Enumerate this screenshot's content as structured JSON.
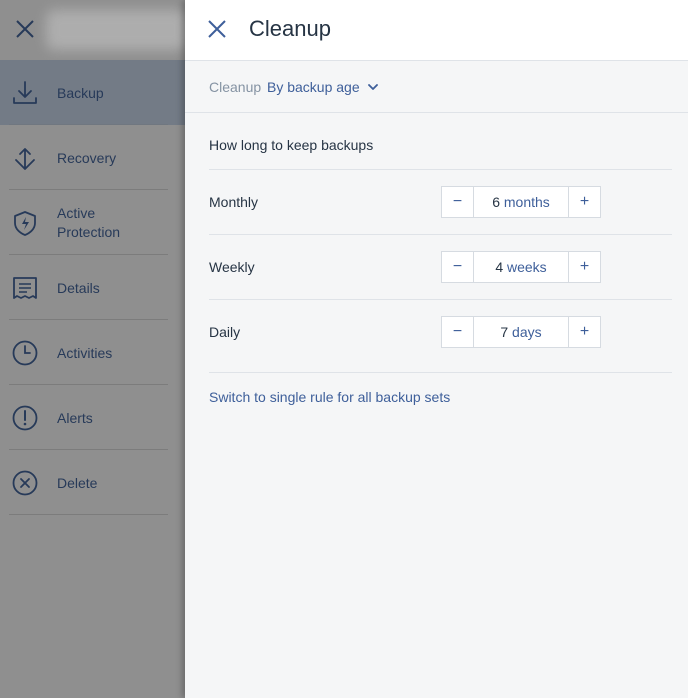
{
  "sidebar": {
    "items": [
      {
        "label": "Backup",
        "icon": "download-icon",
        "active": true
      },
      {
        "label": "Recovery",
        "icon": "recovery-icon",
        "active": false
      },
      {
        "label": "Active Protection",
        "icon": "shield-icon",
        "active": false
      },
      {
        "label": "Details",
        "icon": "details-icon",
        "active": false
      },
      {
        "label": "Activities",
        "icon": "clock-icon",
        "active": false
      },
      {
        "label": "Alerts",
        "icon": "alert-icon",
        "active": false
      },
      {
        "label": "Delete",
        "icon": "delete-icon",
        "active": false
      }
    ]
  },
  "panel": {
    "title": "Cleanup",
    "mode_label": "Cleanup",
    "mode_value": "By backup age",
    "keep_title": "How long to keep backups",
    "rules": [
      {
        "label": "Monthly",
        "value": "6",
        "unit": "months"
      },
      {
        "label": "Weekly",
        "value": "4",
        "unit": "weeks"
      },
      {
        "label": "Daily",
        "value": "7",
        "unit": "days"
      }
    ],
    "switch_link": "Switch to single rule for all backup sets"
  },
  "colors": {
    "accent": "#3e5f9a",
    "text": "#263444",
    "muted": "#8593a3",
    "sidebar_bg": "#8f8f8f",
    "sidebar_active": "#737b86",
    "sidebar_text": "#273a59"
  }
}
